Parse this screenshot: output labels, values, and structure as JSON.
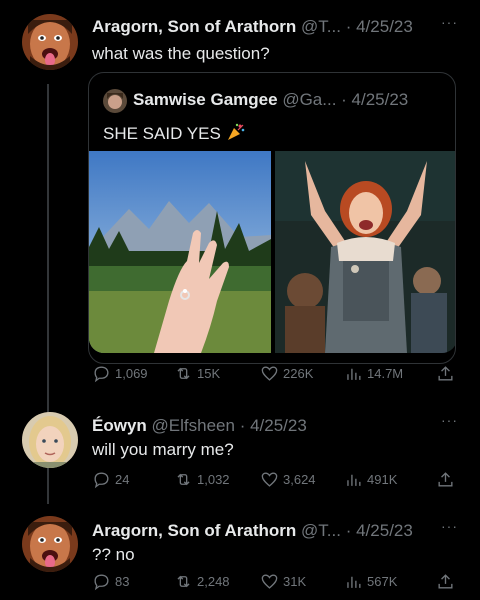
{
  "tweets": [
    {
      "name": "Aragorn, Son of Arathorn",
      "handle": "@T...",
      "date": "· 4/25/23",
      "text": "what was the question?",
      "more": "···",
      "quote": {
        "name": "Samwise Gamgee",
        "handle": "@Ga...",
        "date": "· 4/25/23",
        "text": "SHE SAID YES",
        "emoji": "party-popper-icon"
      },
      "stats": {
        "replies": "1,069",
        "retweets": "15K",
        "likes": "226K",
        "views": "14.7M"
      }
    },
    {
      "name": "Éowyn",
      "handle": "@Elfsheen",
      "date": "· 4/25/23",
      "text": "will you marry me?",
      "more": "···",
      "stats": {
        "replies": "24",
        "retweets": "1,032",
        "likes": "3,624",
        "views": "491K"
      }
    },
    {
      "name": "Aragorn, Son of Arathorn",
      "handle": "@T...",
      "date": "· 4/25/23",
      "text": "?? no",
      "more": "···",
      "stats": {
        "replies": "83",
        "retweets": "2,248",
        "likes": "31K",
        "views": "567K"
      }
    }
  ],
  "colors": {
    "background": "#000000",
    "text": "#e7e9ea",
    "muted": "#71767b",
    "border": "#2f3336"
  }
}
